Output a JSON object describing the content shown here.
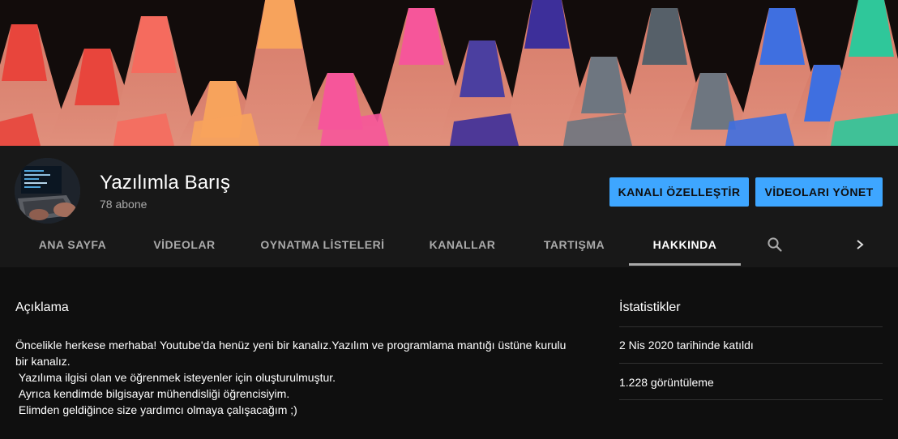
{
  "channel": {
    "name": "Yazılımla Barış",
    "subscribers": "78 abone"
  },
  "buttons": {
    "customize": "KANALI ÖZELLEŞTİR",
    "manage_videos": "VİDEOLARI YÖNET"
  },
  "tabs": [
    {
      "label": "ANA SAYFA",
      "active": false
    },
    {
      "label": "VİDEOLAR",
      "active": false
    },
    {
      "label": "OYNATMA LİSTELERİ",
      "active": false
    },
    {
      "label": "KANALLAR",
      "active": false
    },
    {
      "label": "TARTIŞMA",
      "active": false
    },
    {
      "label": "HAKKINDA",
      "active": true
    }
  ],
  "tab_icons": {
    "search": "search-icon",
    "next": "chevron-right-icon"
  },
  "about": {
    "description_title": "Açıklama",
    "description": "Öncelikle herkese merhaba! Youtube'da henüz yeni bir kanalız.Yazılım ve programlama mantığı üstüne kurulu bir kanalız.\n Yazılıma ilgisi olan ve öğrenmek isteyenler için oluşturulmuştur.\n Ayrıca kendimde bilgisayar mühendisliği öğrencisiyim.\n Elimden geldiğince size yardımcı olmaya çalışacağım ;)",
    "stats_title": "İstatistikler",
    "joined": "2 Nis 2020 tarihinde katıldı",
    "views": "1.228 görüntüleme"
  },
  "colors": {
    "accent": "#3ea6ff",
    "background": "#0f0f0f",
    "header_bg": "#181818",
    "muted_text": "#aaaaaa"
  },
  "banner": {
    "pencil_tip_colors": [
      "#e8453c",
      "#f56b5e",
      "#f7a35c",
      "#f6569a",
      "#4b3fa0",
      "#3d2f9a",
      "#6e7680",
      "#566069",
      "#3f6fe0",
      "#2fc79a"
    ]
  }
}
